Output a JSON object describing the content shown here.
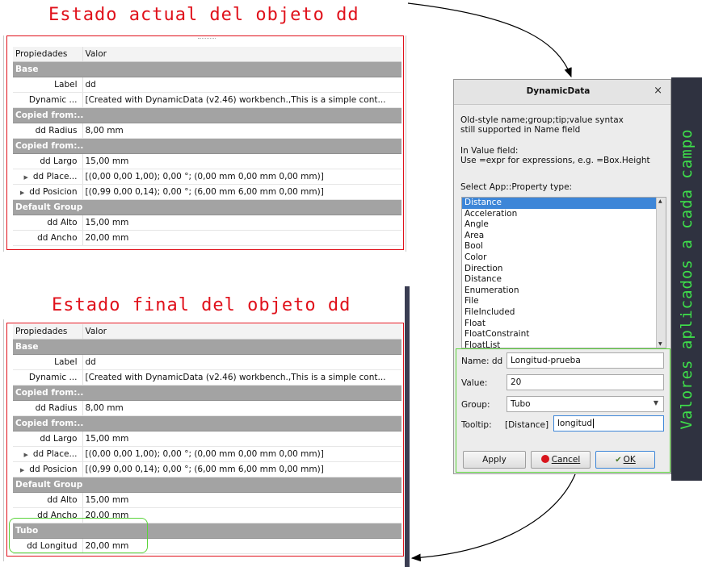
{
  "titles": {
    "current": "Estado actual del objeto dd",
    "final": "Estado final del objeto dd"
  },
  "banner_text": "Valores aplicados a cada campo",
  "property_table": {
    "headers": [
      "Propiedades",
      "Valor"
    ]
  },
  "current_table": [
    {
      "kind": "header",
      "name": "Propiedades",
      "value": "Valor"
    },
    {
      "kind": "group",
      "name": "Base"
    },
    {
      "kind": "prop",
      "name": "Label",
      "value": "dd"
    },
    {
      "kind": "prop",
      "name": "Dynamic ...",
      "value": "[Created with DynamicData (v2.46) workbench.,This is a simple cont..."
    },
    {
      "kind": "group",
      "name": "Copied from:.."
    },
    {
      "kind": "prop",
      "name": "dd Radius",
      "value": "8,00 mm"
    },
    {
      "kind": "group",
      "name": "Copied from:.."
    },
    {
      "kind": "prop",
      "name": "dd Largo",
      "value": "15,00 mm"
    },
    {
      "kind": "prop",
      "name": "dd Place...",
      "value": "[(0,00 0,00 1,00); 0,00 °; (0,00 mm  0,00 mm  0,00 mm)]",
      "expand": true
    },
    {
      "kind": "prop",
      "name": "dd Posicion",
      "value": "[(0,99 0,00 0,14); 0,00 °; (6,00 mm  6,00 mm  0,00 mm)]",
      "expand": true
    },
    {
      "kind": "group",
      "name": "Default Group"
    },
    {
      "kind": "prop",
      "name": "dd Alto",
      "value": "15,00 mm"
    },
    {
      "kind": "prop",
      "name": "dd Ancho",
      "value": "20,00 mm"
    }
  ],
  "final_table": [
    {
      "kind": "header",
      "name": "Propiedades",
      "value": "Valor"
    },
    {
      "kind": "group",
      "name": "Base"
    },
    {
      "kind": "prop",
      "name": "Label",
      "value": "dd"
    },
    {
      "kind": "prop",
      "name": "Dynamic ...",
      "value": "[Created with DynamicData (v2.46) workbench.,This is a simple cont..."
    },
    {
      "kind": "group",
      "name": "Copied from:.."
    },
    {
      "kind": "prop",
      "name": "dd Radius",
      "value": "8,00 mm"
    },
    {
      "kind": "group",
      "name": "Copied from:.."
    },
    {
      "kind": "prop",
      "name": "dd Largo",
      "value": "15,00 mm"
    },
    {
      "kind": "prop",
      "name": "dd Place...",
      "value": "[(0,00 0,00 1,00); 0,00 °; (0,00 mm  0,00 mm  0,00 mm)]",
      "expand": true
    },
    {
      "kind": "prop",
      "name": "dd Posicion",
      "value": "[(0,99 0,00 0,14); 0,00 °; (6,00 mm  6,00 mm  0,00 mm)]",
      "expand": true
    },
    {
      "kind": "group",
      "name": "Default Group"
    },
    {
      "kind": "prop",
      "name": "dd Alto",
      "value": "15,00 mm"
    },
    {
      "kind": "prop",
      "name": "dd Ancho",
      "value": "20,00 mm"
    },
    {
      "kind": "group",
      "name": "Tubo"
    },
    {
      "kind": "prop",
      "name": "dd Longitud",
      "value": "20,00 mm"
    }
  ],
  "dialog": {
    "title": "DynamicData",
    "close": "×",
    "info1": "Old-style name;group;tip;value syntax",
    "info2": "still supported in Name field",
    "info3": "In Value field:",
    "info4": "Use =expr for expressions, e.g. =Box.Height",
    "type_label": "Select App::Property type:",
    "types": [
      "Distance",
      "Acceleration",
      "Angle",
      "Area",
      "Bool",
      "Color",
      "Direction",
      "Distance",
      "Enumeration",
      "File",
      "FileIncluded",
      "Float",
      "FloatConstraint",
      "FloatList"
    ],
    "selected_type": "Distance",
    "name_label": "Name: dd",
    "name_value": "Longitud-prueba",
    "value_label": "Value:",
    "value_value": "20",
    "group_label": "Group:",
    "group_value": "Tubo",
    "tooltip_label": "Tooltip:",
    "tooltip_prefix": "[Distance]",
    "tooltip_value": "longitud",
    "apply": "Apply",
    "cancel": "Cancel",
    "ok": "OK"
  },
  "colors": {
    "title_red": "#e0111b",
    "highlight_green": "#5ad33a",
    "banner_bg": "#2f3240",
    "banner_text": "#3ee04a",
    "group_bg": "#a3a3a3",
    "selection_blue": "#3d86d8"
  }
}
